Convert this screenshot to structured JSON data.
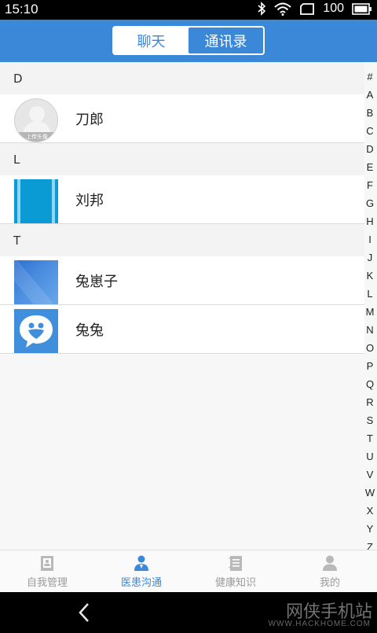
{
  "status_bar": {
    "time": "15:10",
    "battery": "100",
    "icons": [
      "bluetooth-icon",
      "wifi-icon",
      "sim-icon",
      "battery-icon"
    ]
  },
  "header": {
    "tabs": [
      {
        "label": "聊天",
        "active": false
      },
      {
        "label": "通讯录",
        "active": true
      }
    ],
    "accent_color": "#3b87d8"
  },
  "contacts": [
    {
      "letter": "D",
      "items": [
        {
          "name": "刀郎",
          "avatar": "default-avatar",
          "avatar_caption": "上传头像"
        }
      ]
    },
    {
      "letter": "L",
      "items": [
        {
          "name": "刘邦",
          "avatar": "blue-striped-avatar"
        }
      ]
    },
    {
      "letter": "T",
      "items": [
        {
          "name": "兔崽子",
          "avatar": "blue-gradient-avatar"
        },
        {
          "name": "兔兔",
          "avatar": "heart-chat-avatar"
        }
      ]
    }
  ],
  "index_letters": [
    "#",
    "A",
    "B",
    "C",
    "D",
    "E",
    "F",
    "G",
    "H",
    "I",
    "J",
    "K",
    "L",
    "M",
    "N",
    "O",
    "P",
    "Q",
    "R",
    "S",
    "T",
    "U",
    "V",
    "W",
    "X",
    "Y",
    "Z"
  ],
  "bottom_nav": [
    {
      "label": "自我管理",
      "icon": "id-card-icon",
      "active": false
    },
    {
      "label": "医患沟通",
      "icon": "doctor-icon",
      "active": true
    },
    {
      "label": "健康知识",
      "icon": "notebook-icon",
      "active": false
    },
    {
      "label": "我的",
      "icon": "person-icon",
      "active": false
    }
  ],
  "watermark": {
    "title": "网侠手机站",
    "url": "WWW.HACKHOME.COM"
  }
}
